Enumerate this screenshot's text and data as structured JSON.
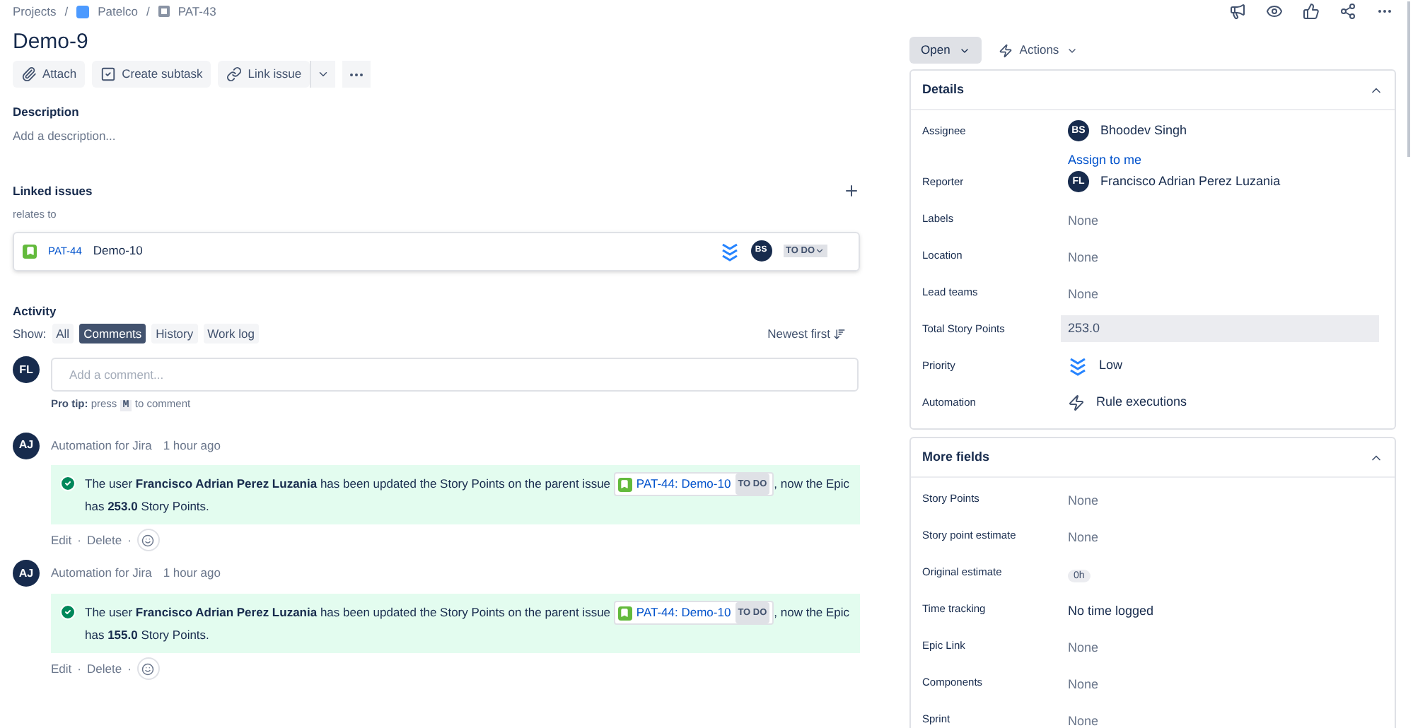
{
  "breadcrumbs": [
    "Projects",
    "Patelco",
    "PAT-43"
  ],
  "breadcrumb_separator": "/",
  "action_separator": "·",
  "title": "Demo-9",
  "toolbar": {
    "buttons": [
      "Attach",
      "Create subtask",
      "Link issue"
    ]
  },
  "description": {
    "heading": "Description",
    "placeholder": "Add a description..."
  },
  "linked_issues": {
    "heading": "Linked issues",
    "relation": "relates to",
    "items": [
      {
        "key": "PAT-44",
        "summary": "Demo-10",
        "assignee_initials": "BS",
        "status": "TO DO"
      }
    ]
  },
  "activity": {
    "heading": "Activity",
    "show_label": "Show:",
    "filters": [
      {
        "label": "All",
        "selected": false
      },
      {
        "label": "Comments",
        "selected": true
      },
      {
        "label": "History",
        "selected": false
      },
      {
        "label": "Work log",
        "selected": false
      }
    ],
    "sort": "Newest first",
    "composer": {
      "initials": "FL",
      "placeholder": "Add a comment...",
      "tip_label": "Pro tip:",
      "tip_before": "press",
      "tip_key": "M",
      "tip_after": "to comment"
    },
    "comments": [
      {
        "initials": "AJ",
        "author": "Automation for Jira",
        "time": "1 hour ago",
        "text_before": "The user **Francisco Adrian Perez Luzania** has been updated the Story Points on the parent issue",
        "issue": "PAT-44: Demo-10",
        "issue_status": "TO DO",
        "text_after": ", now the Epic has **253.0** Story Points.",
        "actions": [
          "Edit",
          "Delete"
        ]
      },
      {
        "initials": "AJ",
        "author": "Automation for Jira",
        "time": "1 hour ago",
        "text_before": "The user **Francisco Adrian Perez Luzania** has been updated the Story Points on the parent issue",
        "issue": "PAT-44: Demo-10",
        "issue_status": "TO DO",
        "text_after": ", now the Epic has **155.0** Story Points.",
        "actions": [
          "Edit",
          "Delete"
        ]
      }
    ]
  },
  "status_button": "Open",
  "actions_button": "Actions",
  "panels": [
    {
      "title": "Details",
      "expanded": true,
      "fields": [
        {
          "label": "Assignee",
          "kind": "person",
          "initials": "BS",
          "value": "Bhoodev Singh",
          "link": "Assign to me"
        },
        {
          "label": "Reporter",
          "kind": "person",
          "initials": "FL",
          "value": "Francisco Adrian Perez Luzania"
        },
        {
          "label": "Labels",
          "kind": "empty",
          "value": "None"
        },
        {
          "label": "Location",
          "kind": "empty",
          "value": "None"
        },
        {
          "label": "Lead teams",
          "kind": "empty",
          "value": "None"
        },
        {
          "label": "Total Story Points",
          "kind": "readonly",
          "value": "253.0"
        },
        {
          "label": "Priority",
          "kind": "priority",
          "value": "Low"
        },
        {
          "label": "Automation",
          "kind": "automation",
          "value": "Rule executions"
        }
      ]
    },
    {
      "title": "More fields",
      "expanded": true,
      "fields": [
        {
          "label": "Story Points",
          "kind": "empty",
          "value": "None"
        },
        {
          "label": "Story point estimate",
          "kind": "empty",
          "value": "None"
        },
        {
          "label": "Original estimate",
          "kind": "chip",
          "value": "0h"
        },
        {
          "label": "Time tracking",
          "kind": "text",
          "value": "No time logged"
        },
        {
          "label": "Epic Link",
          "kind": "empty",
          "value": "None"
        },
        {
          "label": "Components",
          "kind": "empty",
          "value": "None"
        },
        {
          "label": "Sprint",
          "kind": "empty",
          "value": "None"
        }
      ]
    }
  ]
}
